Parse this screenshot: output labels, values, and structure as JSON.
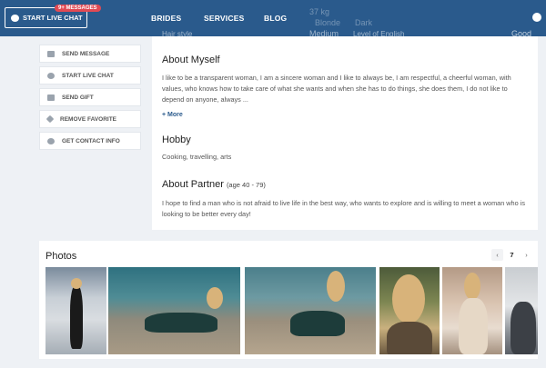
{
  "header": {
    "chat_button_label": "START LIVE CHAT",
    "badge": "9+ MESSAGES",
    "nav": [
      {
        "label": "BRIDES"
      },
      {
        "label": "SERVICES"
      },
      {
        "label": "BLOG"
      }
    ],
    "ghost_texts": [
      "37 kg",
      "Blonde",
      "Dark",
      "Medium",
      "Level of English",
      "Good",
      "Hair style"
    ]
  },
  "actions": [
    {
      "label": "SEND MESSAGE",
      "icon": "envelope-icon"
    },
    {
      "label": "START LIVE CHAT",
      "icon": "chat-bubble-icon"
    },
    {
      "label": "SEND GIFT",
      "icon": "gift-icon"
    },
    {
      "label": "REMOVE FAVORITE",
      "icon": "heart-icon"
    },
    {
      "label": "GET CONTACT INFO",
      "icon": "phone-icon"
    }
  ],
  "profile": {
    "about_title": "About Myself",
    "about_text": "I like to be a transparent woman, I am a sincere woman and I like to always be, I am respectful, a cheerful woman, with values, who knows how to take care of what she wants and when she has to do things, she does them, I do not like to depend on anyone, always ...",
    "more_label": "+ More",
    "hobby_title": "Hobby",
    "hobby_text": "Cooking, travelling, arts",
    "partner_title": "About Partner",
    "partner_age": "(age 40 - 79)",
    "partner_text": "I hope to find a man who is not afraid to live life in the best way, who wants to explore and is willing to meet a woman who is looking to be better every day!"
  },
  "photos": {
    "title": "Photos",
    "prev": "‹",
    "page": "7",
    "next": "›",
    "count": 6
  },
  "colors": {
    "header_bg": "#2a5a8c",
    "badge": "#e14a54",
    "link": "#2a5a8c"
  }
}
